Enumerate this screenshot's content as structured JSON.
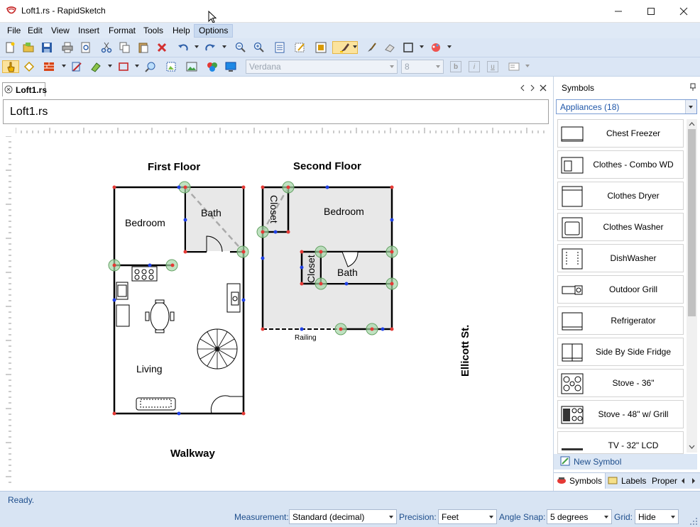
{
  "window": {
    "title": "Loft1.rs - RapidSketch",
    "minimize_icon": "minimize-icon",
    "maximize_icon": "maximize-icon",
    "close_icon": "close-icon"
  },
  "menu": [
    "File",
    "Edit",
    "View",
    "Insert",
    "Format",
    "Tools",
    "Help",
    "Options"
  ],
  "toolbar2": {
    "font_name": "Verdana",
    "font_size": "8",
    "bold": "b",
    "italic": "i",
    "underline": "u"
  },
  "document": {
    "tab_label": "Loft1.rs",
    "title": "Loft1.rs"
  },
  "drawing": {
    "labels": {
      "first_floor": "First Floor",
      "second_floor": "Second Floor",
      "bedroom1": "Bedroom",
      "bath1": "Bath",
      "living": "Living",
      "bedroom2": "Bedroom",
      "closet_top": "Closet",
      "closet_mid": "Closet",
      "bath2": "Bath",
      "railing": "Railing",
      "walkway": "Walkway",
      "street": "Ellicott St."
    }
  },
  "symbols_panel": {
    "title": "Symbols",
    "pin_icon": "pin-icon",
    "category": "Appliances (18)",
    "items": [
      {
        "label": "Chest Freezer",
        "icon": "chest-freezer-icon"
      },
      {
        "label": "Clothes - Combo WD",
        "icon": "combo-washer-dryer-icon"
      },
      {
        "label": "Clothes Dryer",
        "icon": "clothes-dryer-icon"
      },
      {
        "label": "Clothes Washer",
        "icon": "clothes-washer-icon"
      },
      {
        "label": "DishWasher",
        "icon": "dishwasher-icon"
      },
      {
        "label": "Outdoor Grill",
        "icon": "outdoor-grill-icon"
      },
      {
        "label": "Refrigerator",
        "icon": "refrigerator-icon"
      },
      {
        "label": "Side By Side Fridge",
        "icon": "side-by-side-fridge-icon"
      },
      {
        "label": "Stove - 36\"",
        "icon": "stove-36-icon"
      },
      {
        "label": "Stove - 48\" w/ Grill",
        "icon": "stove-48-grill-icon"
      },
      {
        "label": "TV - 32\" LCD",
        "icon": "tv-lcd-icon"
      }
    ],
    "new_symbol": "New Symbol",
    "tabs": [
      "Symbols",
      "Labels",
      "Proper"
    ]
  },
  "status": {
    "text": "Ready.",
    "measurement_label": "Measurement:",
    "measurement_value": "Standard (decimal)",
    "precision_label": "Precision:",
    "precision_value": "Feet",
    "angle_snap_label": "Angle Snap:",
    "angle_snap_value": "5 degrees",
    "grid_label": "Grid:",
    "grid_value": "Hide"
  }
}
